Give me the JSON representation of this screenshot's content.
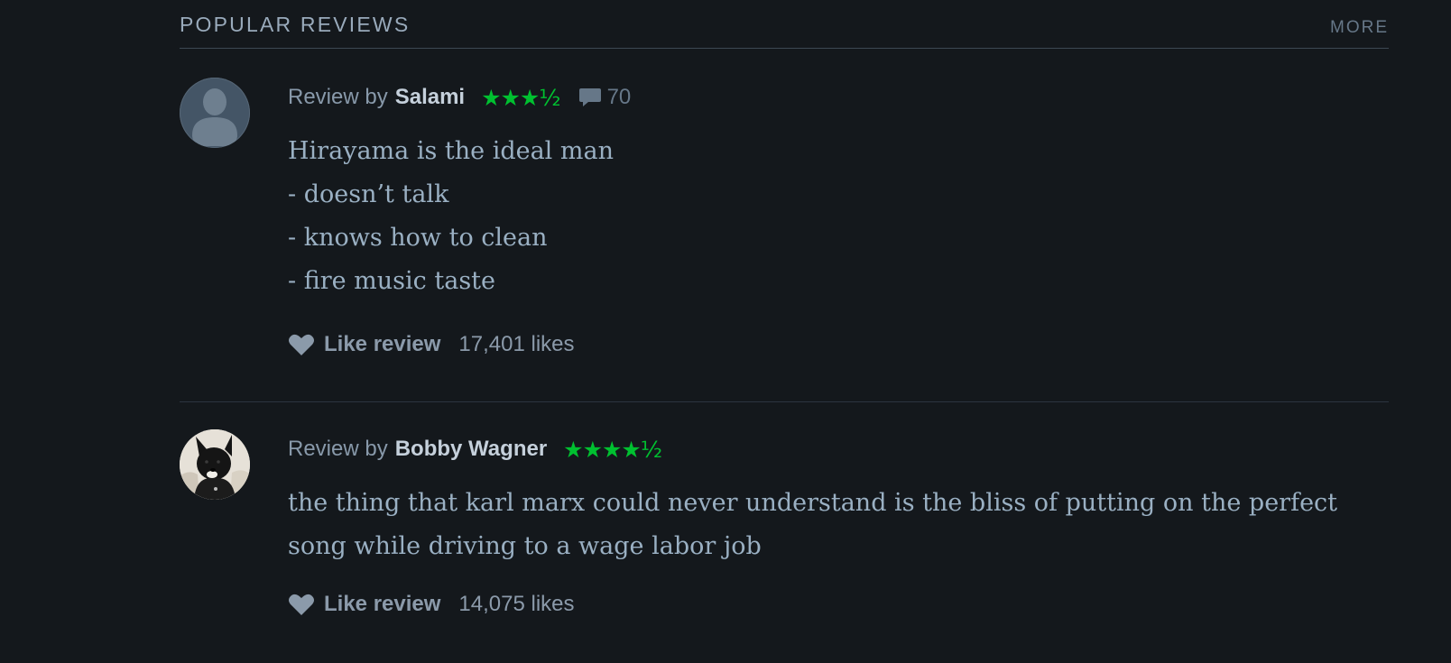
{
  "section": {
    "title": "POPULAR REVIEWS",
    "more_label": "MORE"
  },
  "reviews": [
    {
      "by_prefix": "Review by",
      "author": "Salami",
      "rating_stars": "★★★½",
      "rating_value": 3.5,
      "comment_count": "70",
      "lines": [
        "Hirayama is the ideal man",
        "- doesn’t talk",
        "- knows how to clean",
        "- fire music taste"
      ],
      "like_label": "Like review",
      "likes": "17,401 likes"
    },
    {
      "by_prefix": "Review by",
      "author": "Bobby Wagner",
      "rating_stars": "★★★★½",
      "rating_value": 4.5,
      "lines": [
        "the thing that karl marx could never understand is the bliss of putting on the perfect",
        "song while driving to a wage labor job"
      ],
      "like_label": "Like review",
      "likes": "14,075 likes"
    }
  ],
  "icons": {
    "default_avatar": "person-silhouette-icon",
    "dog_avatar": "dog-photo-avatar",
    "comment": "speech-bubble-icon",
    "like": "heart-icon"
  },
  "colors": {
    "background": "#14181c",
    "star_green": "#00c030",
    "author": "#c5d0db",
    "muted": "#8899aa",
    "body_text": "#9ab0c3"
  }
}
